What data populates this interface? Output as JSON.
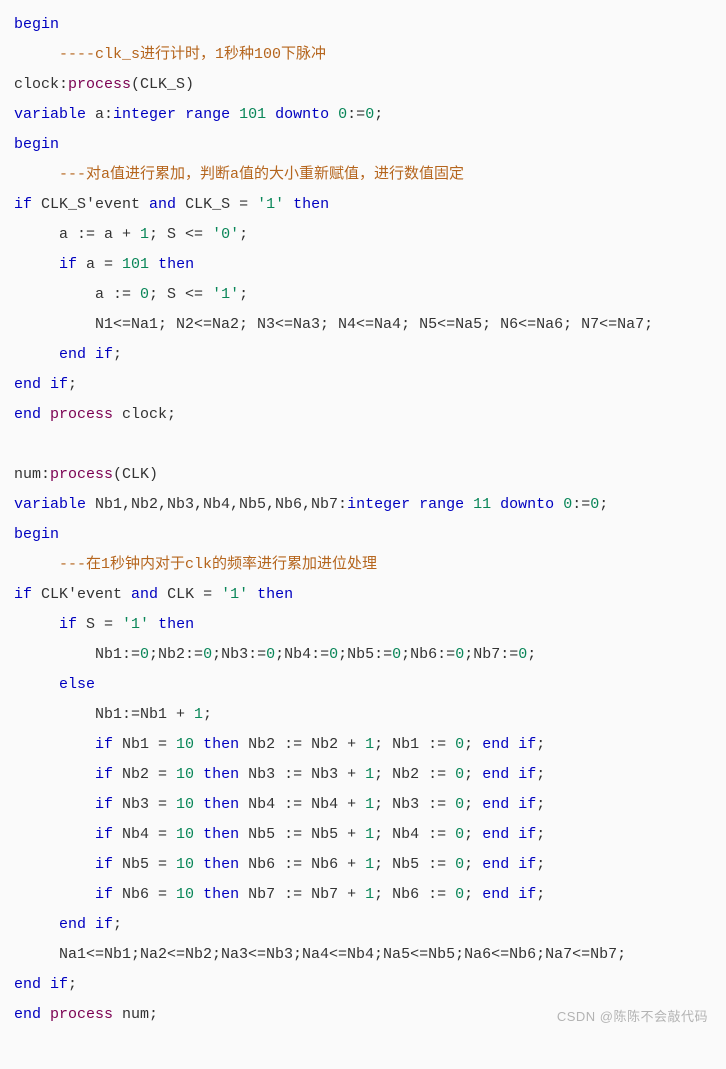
{
  "lines": [
    {
      "segments": [
        {
          "t": "begin",
          "c": "kw"
        }
      ]
    },
    {
      "segments": [
        {
          "t": "     ----clk_s进行计时，1秒种100下脉冲",
          "c": "cmt"
        }
      ]
    },
    {
      "segments": [
        {
          "t": "clock",
          "c": ""
        },
        {
          "t": ":",
          "c": ""
        },
        {
          "t": "process",
          "c": "proc"
        },
        {
          "t": "(CLK_S)",
          "c": ""
        }
      ]
    },
    {
      "segments": [
        {
          "t": "variable",
          "c": "kw"
        },
        {
          "t": " a:",
          "c": ""
        },
        {
          "t": "integer",
          "c": "kw"
        },
        {
          "t": " ",
          "c": ""
        },
        {
          "t": "range",
          "c": "kw"
        },
        {
          "t": " ",
          "c": ""
        },
        {
          "t": "101",
          "c": "num"
        },
        {
          "t": " ",
          "c": ""
        },
        {
          "t": "downto",
          "c": "kw"
        },
        {
          "t": " ",
          "c": ""
        },
        {
          "t": "0",
          "c": "num"
        },
        {
          "t": ":=",
          "c": ""
        },
        {
          "t": "0",
          "c": "num"
        },
        {
          "t": ";",
          "c": ""
        }
      ]
    },
    {
      "segments": [
        {
          "t": "begin",
          "c": "kw"
        }
      ]
    },
    {
      "segments": [
        {
          "t": "     ---对a值进行累加，判断a值的大小重新赋值，进行数值固定",
          "c": "cmt"
        }
      ]
    },
    {
      "segments": [
        {
          "t": "if",
          "c": "kw"
        },
        {
          "t": " CLK_S'event ",
          "c": ""
        },
        {
          "t": "and",
          "c": "kw"
        },
        {
          "t": " CLK_S = ",
          "c": ""
        },
        {
          "t": "'1'",
          "c": "str"
        },
        {
          "t": " ",
          "c": ""
        },
        {
          "t": "then",
          "c": "kw"
        }
      ]
    },
    {
      "segments": [
        {
          "t": "     a := a + ",
          "c": ""
        },
        {
          "t": "1",
          "c": "num"
        },
        {
          "t": "; S <= ",
          "c": ""
        },
        {
          "t": "'0'",
          "c": "str"
        },
        {
          "t": ";",
          "c": ""
        }
      ]
    },
    {
      "segments": [
        {
          "t": "     ",
          "c": ""
        },
        {
          "t": "if",
          "c": "kw"
        },
        {
          "t": " a = ",
          "c": ""
        },
        {
          "t": "101",
          "c": "num"
        },
        {
          "t": " ",
          "c": ""
        },
        {
          "t": "then",
          "c": "kw"
        }
      ]
    },
    {
      "segments": [
        {
          "t": "         a := ",
          "c": ""
        },
        {
          "t": "0",
          "c": "num"
        },
        {
          "t": "; S <= ",
          "c": ""
        },
        {
          "t": "'1'",
          "c": "str"
        },
        {
          "t": ";",
          "c": ""
        }
      ]
    },
    {
      "segments": [
        {
          "t": "         N1<=Na1; N2<=Na2; N3<=Na3; N4<=Na4; N5<=Na5; N6<=Na6; N7<=Na7;",
          "c": ""
        }
      ]
    },
    {
      "segments": [
        {
          "t": "     ",
          "c": ""
        },
        {
          "t": "end if",
          "c": "kw"
        },
        {
          "t": ";",
          "c": ""
        }
      ]
    },
    {
      "segments": [
        {
          "t": "end if",
          "c": "kw"
        },
        {
          "t": ";",
          "c": ""
        }
      ]
    },
    {
      "segments": [
        {
          "t": "end",
          "c": "kw"
        },
        {
          "t": " ",
          "c": ""
        },
        {
          "t": "process",
          "c": "proc"
        },
        {
          "t": " clock;",
          "c": ""
        }
      ]
    },
    {
      "segments": [
        {
          "t": " ",
          "c": ""
        }
      ]
    },
    {
      "segments": [
        {
          "t": "num:",
          "c": ""
        },
        {
          "t": "process",
          "c": "proc"
        },
        {
          "t": "(CLK)",
          "c": ""
        }
      ]
    },
    {
      "segments": [
        {
          "t": "variable",
          "c": "kw"
        },
        {
          "t": " Nb1,Nb2,Nb3,Nb4,Nb5,Nb6,Nb7:",
          "c": ""
        },
        {
          "t": "integer",
          "c": "kw"
        },
        {
          "t": " ",
          "c": ""
        },
        {
          "t": "range",
          "c": "kw"
        },
        {
          "t": " ",
          "c": ""
        },
        {
          "t": "11",
          "c": "num"
        },
        {
          "t": " ",
          "c": ""
        },
        {
          "t": "downto",
          "c": "kw"
        },
        {
          "t": " ",
          "c": ""
        },
        {
          "t": "0",
          "c": "num"
        },
        {
          "t": ":=",
          "c": ""
        },
        {
          "t": "0",
          "c": "num"
        },
        {
          "t": ";",
          "c": ""
        }
      ]
    },
    {
      "segments": [
        {
          "t": "begin",
          "c": "kw"
        }
      ]
    },
    {
      "segments": [
        {
          "t": "     ---在1秒钟内对于clk的频率进行累加进位处理",
          "c": "cmt"
        }
      ]
    },
    {
      "segments": [
        {
          "t": "if",
          "c": "kw"
        },
        {
          "t": " CLK'event ",
          "c": ""
        },
        {
          "t": "and",
          "c": "kw"
        },
        {
          "t": " CLK = ",
          "c": ""
        },
        {
          "t": "'1'",
          "c": "str"
        },
        {
          "t": " ",
          "c": ""
        },
        {
          "t": "then",
          "c": "kw"
        }
      ]
    },
    {
      "segments": [
        {
          "t": "     ",
          "c": ""
        },
        {
          "t": "if",
          "c": "kw"
        },
        {
          "t": " S = ",
          "c": ""
        },
        {
          "t": "'1'",
          "c": "str"
        },
        {
          "t": " ",
          "c": ""
        },
        {
          "t": "then",
          "c": "kw"
        }
      ]
    },
    {
      "segments": [
        {
          "t": "         Nb1:=",
          "c": ""
        },
        {
          "t": "0",
          "c": "num"
        },
        {
          "t": ";Nb2:=",
          "c": ""
        },
        {
          "t": "0",
          "c": "num"
        },
        {
          "t": ";Nb3:=",
          "c": ""
        },
        {
          "t": "0",
          "c": "num"
        },
        {
          "t": ";Nb4:=",
          "c": ""
        },
        {
          "t": "0",
          "c": "num"
        },
        {
          "t": ";Nb5:=",
          "c": ""
        },
        {
          "t": "0",
          "c": "num"
        },
        {
          "t": ";Nb6:=",
          "c": ""
        },
        {
          "t": "0",
          "c": "num"
        },
        {
          "t": ";Nb7:=",
          "c": ""
        },
        {
          "t": "0",
          "c": "num"
        },
        {
          "t": ";",
          "c": ""
        }
      ]
    },
    {
      "segments": [
        {
          "t": "     ",
          "c": ""
        },
        {
          "t": "else",
          "c": "kw"
        }
      ]
    },
    {
      "segments": [
        {
          "t": "         Nb1:=Nb1 + ",
          "c": ""
        },
        {
          "t": "1",
          "c": "num"
        },
        {
          "t": ";",
          "c": ""
        }
      ]
    },
    {
      "segments": [
        {
          "t": "         ",
          "c": ""
        },
        {
          "t": "if",
          "c": "kw"
        },
        {
          "t": " Nb1 = ",
          "c": ""
        },
        {
          "t": "10",
          "c": "num"
        },
        {
          "t": " ",
          "c": ""
        },
        {
          "t": "then",
          "c": "kw"
        },
        {
          "t": " Nb2 := Nb2 + ",
          "c": ""
        },
        {
          "t": "1",
          "c": "num"
        },
        {
          "t": "; Nb1 := ",
          "c": ""
        },
        {
          "t": "0",
          "c": "num"
        },
        {
          "t": "; ",
          "c": ""
        },
        {
          "t": "end if",
          "c": "kw"
        },
        {
          "t": ";",
          "c": ""
        }
      ]
    },
    {
      "segments": [
        {
          "t": "         ",
          "c": ""
        },
        {
          "t": "if",
          "c": "kw"
        },
        {
          "t": " Nb2 = ",
          "c": ""
        },
        {
          "t": "10",
          "c": "num"
        },
        {
          "t": " ",
          "c": ""
        },
        {
          "t": "then",
          "c": "kw"
        },
        {
          "t": " Nb3 := Nb3 + ",
          "c": ""
        },
        {
          "t": "1",
          "c": "num"
        },
        {
          "t": "; Nb2 := ",
          "c": ""
        },
        {
          "t": "0",
          "c": "num"
        },
        {
          "t": "; ",
          "c": ""
        },
        {
          "t": "end if",
          "c": "kw"
        },
        {
          "t": ";",
          "c": ""
        }
      ]
    },
    {
      "segments": [
        {
          "t": "         ",
          "c": ""
        },
        {
          "t": "if",
          "c": "kw"
        },
        {
          "t": " Nb3 = ",
          "c": ""
        },
        {
          "t": "10",
          "c": "num"
        },
        {
          "t": " ",
          "c": ""
        },
        {
          "t": "then",
          "c": "kw"
        },
        {
          "t": " Nb4 := Nb4 + ",
          "c": ""
        },
        {
          "t": "1",
          "c": "num"
        },
        {
          "t": "; Nb3 := ",
          "c": ""
        },
        {
          "t": "0",
          "c": "num"
        },
        {
          "t": "; ",
          "c": ""
        },
        {
          "t": "end if",
          "c": "kw"
        },
        {
          "t": ";",
          "c": ""
        }
      ]
    },
    {
      "segments": [
        {
          "t": "         ",
          "c": ""
        },
        {
          "t": "if",
          "c": "kw"
        },
        {
          "t": " Nb4 = ",
          "c": ""
        },
        {
          "t": "10",
          "c": "num"
        },
        {
          "t": " ",
          "c": ""
        },
        {
          "t": "then",
          "c": "kw"
        },
        {
          "t": " Nb5 := Nb5 + ",
          "c": ""
        },
        {
          "t": "1",
          "c": "num"
        },
        {
          "t": "; Nb4 := ",
          "c": ""
        },
        {
          "t": "0",
          "c": "num"
        },
        {
          "t": "; ",
          "c": ""
        },
        {
          "t": "end if",
          "c": "kw"
        },
        {
          "t": ";",
          "c": ""
        }
      ]
    },
    {
      "segments": [
        {
          "t": "         ",
          "c": ""
        },
        {
          "t": "if",
          "c": "kw"
        },
        {
          "t": " Nb5 = ",
          "c": ""
        },
        {
          "t": "10",
          "c": "num"
        },
        {
          "t": " ",
          "c": ""
        },
        {
          "t": "then",
          "c": "kw"
        },
        {
          "t": " Nb6 := Nb6 + ",
          "c": ""
        },
        {
          "t": "1",
          "c": "num"
        },
        {
          "t": "; Nb5 := ",
          "c": ""
        },
        {
          "t": "0",
          "c": "num"
        },
        {
          "t": "; ",
          "c": ""
        },
        {
          "t": "end if",
          "c": "kw"
        },
        {
          "t": ";",
          "c": ""
        }
      ]
    },
    {
      "segments": [
        {
          "t": "         ",
          "c": ""
        },
        {
          "t": "if",
          "c": "kw"
        },
        {
          "t": " Nb6 = ",
          "c": ""
        },
        {
          "t": "10",
          "c": "num"
        },
        {
          "t": " ",
          "c": ""
        },
        {
          "t": "then",
          "c": "kw"
        },
        {
          "t": " Nb7 := Nb7 + ",
          "c": ""
        },
        {
          "t": "1",
          "c": "num"
        },
        {
          "t": "; Nb6 := ",
          "c": ""
        },
        {
          "t": "0",
          "c": "num"
        },
        {
          "t": "; ",
          "c": ""
        },
        {
          "t": "end if",
          "c": "kw"
        },
        {
          "t": ";",
          "c": ""
        }
      ]
    },
    {
      "segments": [
        {
          "t": "     ",
          "c": ""
        },
        {
          "t": "end if",
          "c": "kw"
        },
        {
          "t": ";",
          "c": ""
        }
      ]
    },
    {
      "segments": [
        {
          "t": "     Na1<=Nb1;Na2<=Nb2;Na3<=Nb3;Na4<=Nb4;Na5<=Nb5;Na6<=Nb6;Na7<=Nb7;",
          "c": ""
        }
      ]
    },
    {
      "segments": [
        {
          "t": "end if",
          "c": "kw"
        },
        {
          "t": ";",
          "c": ""
        }
      ]
    },
    {
      "segments": [
        {
          "t": "end",
          "c": "kw"
        },
        {
          "t": " ",
          "c": ""
        },
        {
          "t": "process",
          "c": "proc"
        },
        {
          "t": " num;",
          "c": ""
        }
      ]
    }
  ],
  "watermark": "CSDN @陈陈不会敲代码"
}
